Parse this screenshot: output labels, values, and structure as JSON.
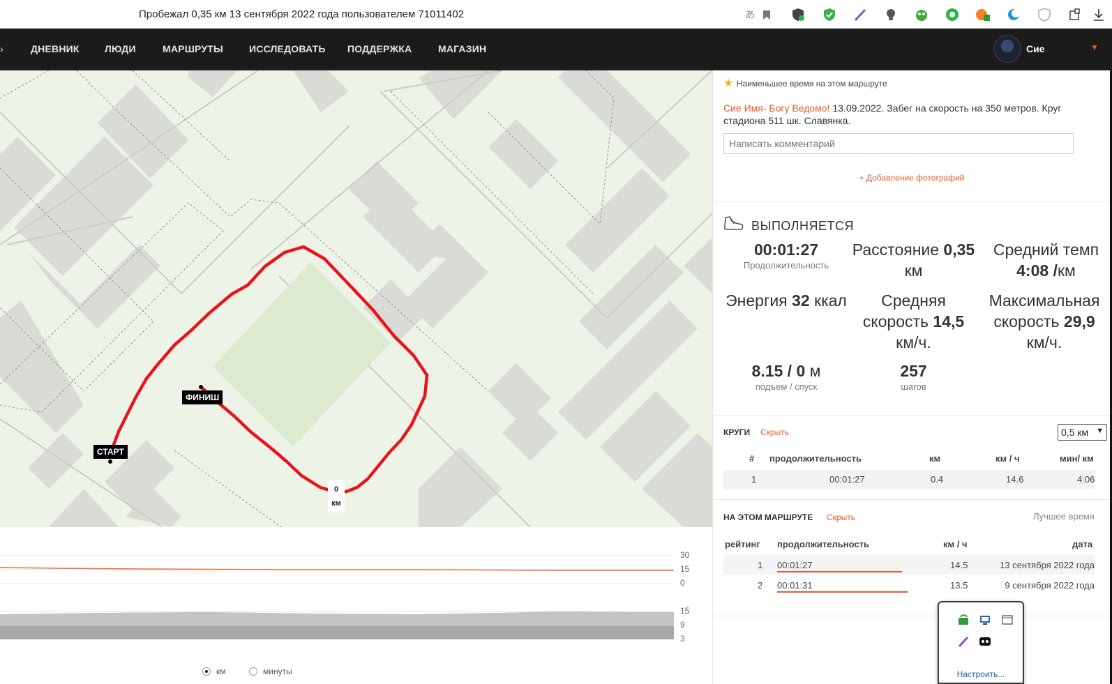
{
  "browser": {
    "title": "Пробежал 0,35 км 13 сентября 2022 года пользователем 71011402",
    "extensions": [
      "translate-icon",
      "bookmark-icon",
      "shield-check-icon",
      "green-shield-icon",
      "feather-icon",
      "bulb-icon",
      "frog-icon",
      "green-circle-icon",
      "orange-badge-icon",
      "moon-icon",
      "gray-shield-icon",
      "puzzle-icon",
      "download-icon"
    ]
  },
  "nav": {
    "left_arrow": "›",
    "items": [
      "ДНЕВНИК",
      "ЛЮДИ",
      "МАРШРУТЫ",
      "ИССЛЕДОВАТЬ",
      "ПОДДЕРЖКА",
      "МАГАЗИН"
    ],
    "user_name": "Сие",
    "caret": "▼"
  },
  "map": {
    "start_label": "СТАРТ",
    "finish_label": "ФИНИШ",
    "km_marker": [
      "0",
      "км"
    ],
    "route_color": "#e8141b"
  },
  "charts": {
    "speed_axis": [
      "30",
      "15",
      "0"
    ],
    "elev_axis": [
      "15",
      "9",
      "3"
    ],
    "x_mode_options": [
      "км",
      "минуты"
    ],
    "x_mode_selected": "км",
    "speed_color": "#ef6f2e"
  },
  "panel": {
    "best_time_note": "Наименьшее время на этом маршруте",
    "user_link": "Сие Имя- Богу Ведомо!",
    "description": " 13.09.2022. Забег на скорость на 350 метров. Круг стадиона 511 шк. Славянка.",
    "comment_placeholder": "Написать комментарий",
    "add_photo": "+ Добавление фотографий",
    "activity_title": "ВЫПОЛНЯЕТСЯ",
    "duration_value": "00:01:27",
    "duration_label": "Продолжительность",
    "distance_prefix": "Расстояние ",
    "distance_value": "0,35",
    "distance_unit": "км",
    "avg_pace_label": "Средний темп",
    "avg_pace_value": "4:08",
    "avg_pace_sep": " /",
    "avg_pace_unit": "км",
    "energy_prefix": "Энергия ",
    "energy_value": "32",
    "energy_unit": " ккал",
    "avg_speed_line1": "Средняя",
    "avg_speed_prefix": "скорость ",
    "avg_speed_value": "14,5",
    "avg_speed_unit": "км/ч.",
    "max_speed_line1": "Максимальная",
    "max_speed_prefix": "скорость ",
    "max_speed_value": "29,9",
    "max_speed_unit": "км/ч.",
    "elev_value": "8.15 / 0",
    "elev_unit": " м",
    "elev_label": "подъем / спуск",
    "steps_value": "257",
    "steps_label": "шагов",
    "laps_title": "КРУГИ",
    "laps_hide": "Скрыть",
    "laps_select": "0,5 км",
    "laps_headers": [
      "#",
      "продолжительность",
      "км",
      "км / ч",
      "мин/ км"
    ],
    "laps_rows": [
      {
        "n": "1",
        "duration": "00:01:27",
        "km": "0.4",
        "kmh": "14.6",
        "pace": "4:06"
      }
    ],
    "route_title": "НА ЭТОМ МАРШРУТЕ",
    "route_hide": "Скрыть",
    "route_best": "Лучшее время",
    "route_headers": [
      "рейтинг",
      "продолжительность",
      "км / ч",
      "дата"
    ],
    "route_rows": [
      {
        "rank": "1",
        "duration": "00:01:27",
        "kmh": "14.5",
        "date": "13 сентября 2022 года",
        "highlight": true
      },
      {
        "rank": "2",
        "duration": "00:01:31",
        "kmh": "13.5",
        "date": "9 сентября 2022 года",
        "highlight": false
      }
    ]
  },
  "popup": {
    "configure": "Настроить..."
  }
}
